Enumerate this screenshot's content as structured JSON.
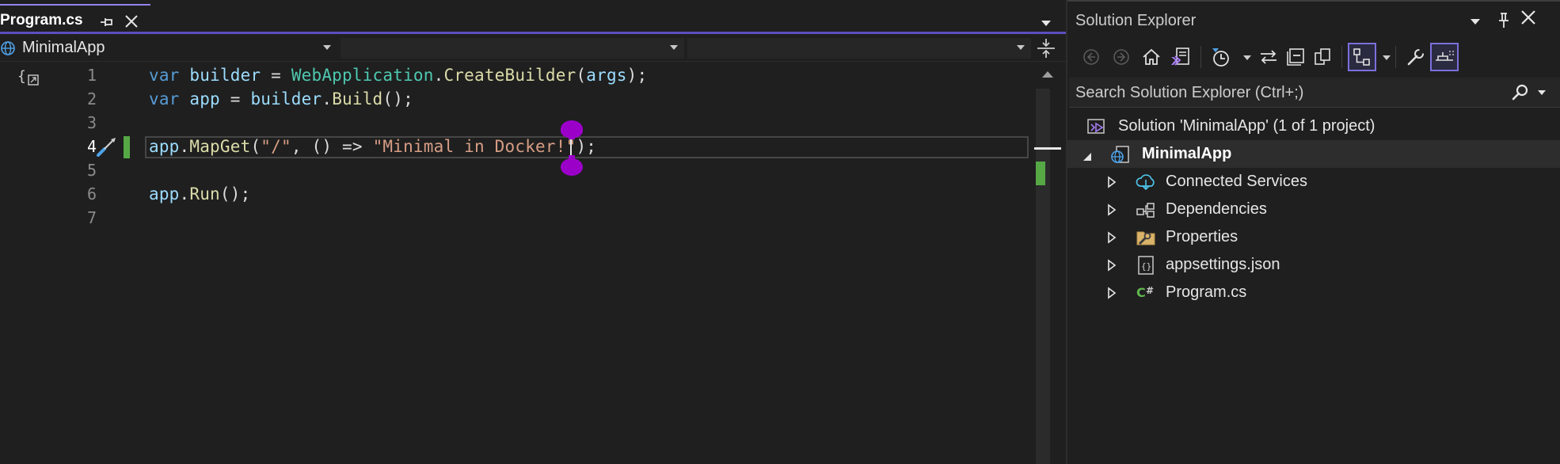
{
  "editor": {
    "tab": {
      "title": "Program.cs",
      "pin_icon": "pin-icon",
      "close_icon": "close-icon"
    },
    "navigation": {
      "project": "MinimalApp",
      "type": "",
      "member": ""
    },
    "lines": [
      {
        "number": "1",
        "code": "var builder = WebApplication.CreateBuilder(args);"
      },
      {
        "number": "2",
        "code": "var app = builder.Build();"
      },
      {
        "number": "3",
        "code": ""
      },
      {
        "number": "4",
        "code": "app.MapGet(\"/\", () => \"Minimal in Docker!\");"
      },
      {
        "number": "5",
        "code": ""
      },
      {
        "number": "6",
        "code": "app.Run();"
      },
      {
        "number": "7",
        "code": ""
      }
    ],
    "current_line": "4",
    "colors": {
      "keyword": "#569cd6",
      "identifier": "#9cdcfe",
      "type": "#4ec9b0",
      "method": "#dcdcaa",
      "string": "#d69d85",
      "change_marker": "#56a845",
      "selection_handle": "#9b00c9",
      "accent": "#9184ee"
    }
  },
  "solution_explorer": {
    "title": "Solution Explorer",
    "search": {
      "placeholder": "Search Solution Explorer (Ctrl+;)"
    },
    "toolbar_icons": [
      "back-icon",
      "forward-icon",
      "home-icon",
      "switch-views-icon",
      "pending-changes-filter-icon",
      "sync-with-document-icon",
      "collapse-all-icon",
      "show-all-files-icon",
      "preview-selected-items-icon",
      "properties-icon",
      "pin-tab-icon"
    ],
    "tree": [
      {
        "label": "Solution 'MinimalApp' (1 of 1 project)",
        "icon": "solution-icon"
      },
      {
        "label": "MinimalApp",
        "icon": "web-project-icon"
      },
      {
        "label": "Connected Services",
        "icon": "connected-services-icon"
      },
      {
        "label": "Dependencies",
        "icon": "dependencies-icon"
      },
      {
        "label": "Properties",
        "icon": "properties-folder-icon"
      },
      {
        "label": "appsettings.json",
        "icon": "json-file-icon"
      },
      {
        "label": "Program.cs",
        "icon": "csharp-file-icon"
      }
    ]
  }
}
